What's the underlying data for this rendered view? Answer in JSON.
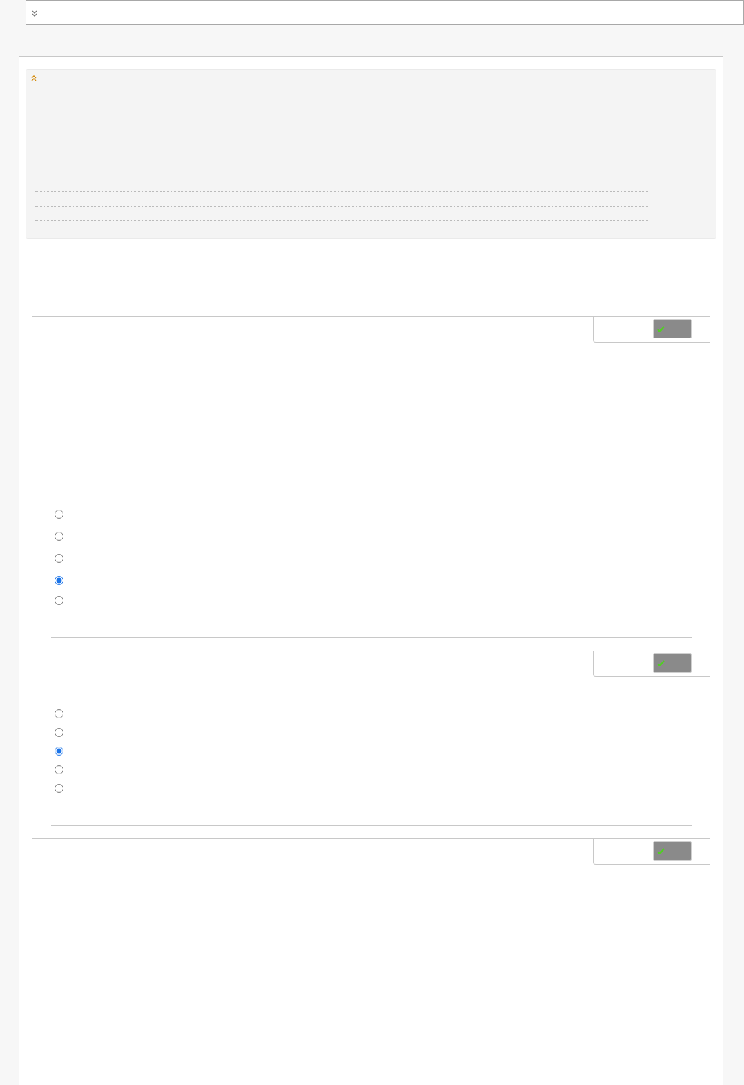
{
  "questions": [
    {
      "kind": "choice",
      "options": [
        {
          "selected": false
        },
        {
          "selected": false
        },
        {
          "selected": false
        },
        {
          "selected": true
        },
        {
          "selected": false
        }
      ]
    },
    {
      "kind": "choice",
      "options": [
        {
          "selected": false
        },
        {
          "selected": false
        },
        {
          "selected": true
        },
        {
          "selected": false
        },
        {
          "selected": false
        }
      ]
    },
    {
      "kind": "open"
    }
  ]
}
